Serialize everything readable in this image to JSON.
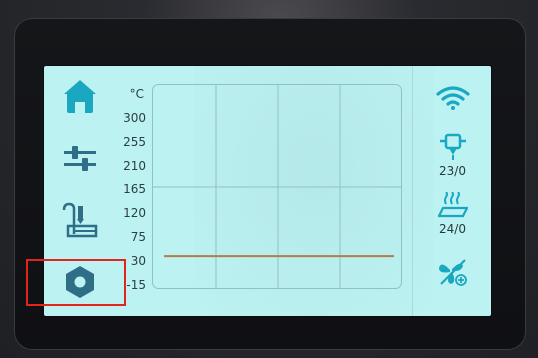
{
  "nav": {
    "items": [
      {
        "icon": "home-icon",
        "active": true
      },
      {
        "icon": "sliders-icon",
        "active": false
      },
      {
        "icon": "print-head-icon",
        "active": false
      },
      {
        "icon": "gear-icon",
        "active": false
      }
    ]
  },
  "chart_data": {
    "type": "line",
    "title": "",
    "xlabel": "",
    "ylabel": "°C",
    "ylim": [
      -15,
      300
    ],
    "ticks": [
      "300",
      "255",
      "210",
      "165",
      "120",
      "75",
      "30",
      "-15"
    ],
    "grid": true,
    "series": [
      {
        "values": [
          24,
          24,
          24,
          24,
          24,
          24,
          24,
          24
        ],
        "color": "#b77a4c"
      }
    ]
  },
  "status": {
    "wifi_icon": "wifi-icon",
    "hotend_icon": "hotend-icon",
    "hotend_value": "23/0",
    "bed_icon": "heated-bed-icon",
    "bed_value": "24/0",
    "fan_icon": "fan-icon"
  },
  "colors": {
    "screen_bg": "#bdf2f2",
    "accent": "#1aa7c2",
    "nav_icon": "#2e6f87",
    "curve": "#b77a4c",
    "highlight": "#e2241d"
  }
}
